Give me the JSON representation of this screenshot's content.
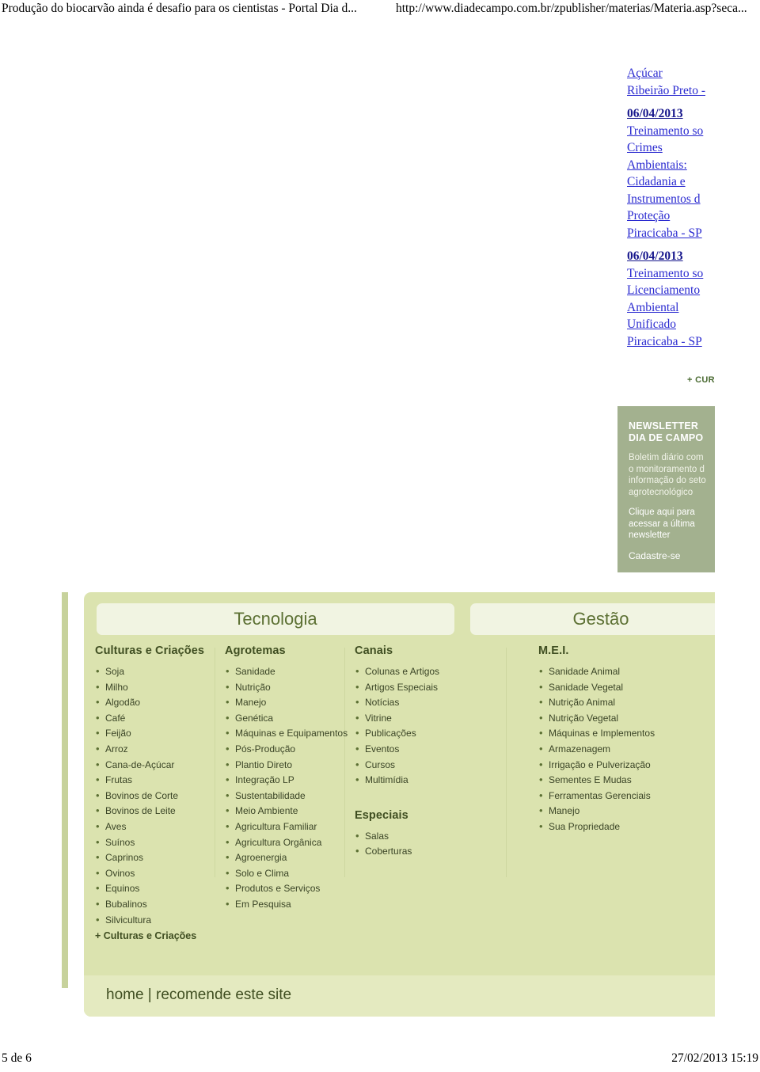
{
  "print_header": {
    "doc_title": "Produção do biocarvão ainda é desafio para os cientistas - Portal Dia d...",
    "url": "http://www.diadecampo.com.br/zpublisher/materias/Materia.asp?seca..."
  },
  "print_footer": {
    "page": "5 de 6",
    "timestamp": "27/02/2013 15:19"
  },
  "rail": {
    "entry0": {
      "line1": "Açúcar",
      "line2": "Ribeirão Preto -"
    },
    "entry1": {
      "date": "06/04/2013",
      "l1": "Treinamento so",
      "l2": "Crimes",
      "l3": "Ambientais:",
      "l4": "Cidadania e",
      "l5": "Instrumentos d",
      "l6": "Proteção",
      "l7": "Piracicaba - SP"
    },
    "entry2": {
      "date": "06/04/2013",
      "l1": "Treinamento so",
      "l2": "Licenciamento",
      "l3": "Ambiental",
      "l4": "Unificado",
      "l5": "Piracicaba - SP"
    },
    "more_cursos": "+ CUR"
  },
  "newsletter": {
    "title_line1": "NEWSLETTER",
    "title_line2": "DIA DE CAMPO",
    "desc_line1": "Boletim diário com",
    "desc_line2": "o monitoramento d",
    "desc_line3": "informação do seto",
    "desc_line4": "agrotecnológico",
    "cta_line1": "Clique aqui para",
    "cta_line2": "acessar a última",
    "cta_line3": "newsletter",
    "signup": "Cadastre-se"
  },
  "sitemap": {
    "tabs": [
      {
        "label": "Tecnologia"
      },
      {
        "label": "Gestão"
      }
    ],
    "columns": [
      {
        "heading": "Culturas e Criações",
        "items": [
          "Soja",
          "Milho",
          "Algodão",
          "Café",
          "Feijão",
          "Arroz",
          "Cana-de-Açúcar",
          "Frutas",
          "Bovinos de Corte",
          "Bovinos de Leite",
          "Aves",
          "Suínos",
          "Caprinos",
          "Ovinos",
          "Equinos",
          "Bubalinos",
          "Silvicultura"
        ],
        "more": "+ Culturas e Criações"
      },
      {
        "heading": "Agrotemas",
        "items": [
          "Sanidade",
          "Nutrição",
          "Manejo",
          "Genética",
          "Máquinas e Equipamentos",
          "Pós-Produção",
          "Plantio Direto",
          "Integração LP",
          "Sustentabilidade",
          "Meio Ambiente",
          "Agricultura Familiar",
          "Agricultura Orgânica",
          "Agroenergia",
          "Solo e Clima",
          "Produtos e Serviços",
          "Em Pesquisa"
        ],
        "more": ""
      },
      {
        "heading": "Canais",
        "items": [
          "Colunas e Artigos",
          "Artigos Especiais",
          "Notícias",
          "Vitrine",
          "Publicações",
          "Eventos",
          "Cursos",
          "Multimídia"
        ],
        "heading2": "Especiais",
        "items2": [
          "Salas",
          "Coberturas"
        ],
        "more": ""
      },
      {
        "heading": "M.E.I.",
        "items": [
          "Sanidade Animal",
          "Sanidade Vegetal",
          "Nutrição Animal",
          "Nutrição Vegetal",
          "Máquinas e Implementos",
          "Armazenagem",
          "Irrigação e Pulverização",
          "Sementes E Mudas",
          "Ferramentas Gerenciais",
          "Manejo",
          "Sua Propriedade"
        ],
        "more": ""
      }
    ],
    "bottom_links": "home | recomende este site"
  },
  "colors": {
    "sitemap_bg": "#dbe3af",
    "tab_bg": "#f1f4e2",
    "bottom_bar_bg": "#e4eac0",
    "newsletter_bg": "#a3b18f",
    "heading_text": "#3f4e21",
    "link_blue": "#2a2ad0",
    "accent_green": "#5c7033"
  }
}
